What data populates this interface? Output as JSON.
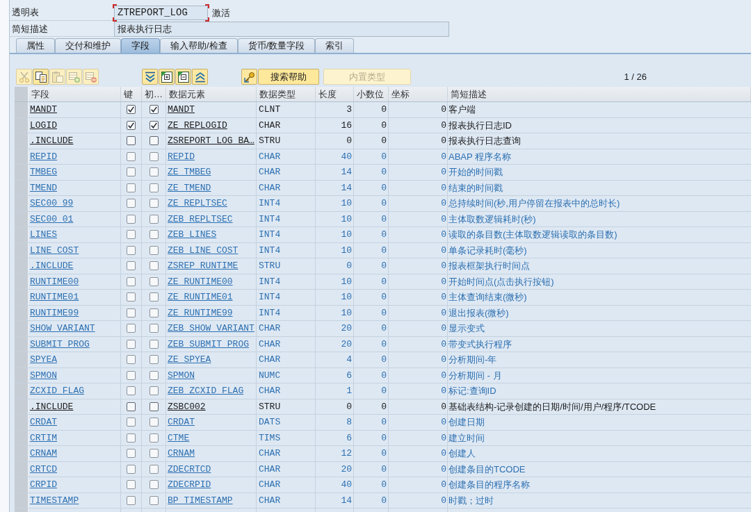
{
  "object": {
    "label": "透明表",
    "value": "ZTREPORT_LOG",
    "focused": true,
    "status": "激活"
  },
  "short_description": {
    "label": "简短描述",
    "value": "报表执行日志"
  },
  "tabs": [
    {
      "label": "属性",
      "selected": false
    },
    {
      "label": "交付和维护",
      "selected": false
    },
    {
      "label": "字段",
      "selected": true
    },
    {
      "label": "输入帮助/检查",
      "selected": false
    },
    {
      "label": "货币/数量字段",
      "selected": false
    },
    {
      "label": "索引",
      "selected": false
    }
  ],
  "toolbar": {
    "groups": [
      {
        "buttons": [
          {
            "kind": "cut",
            "disabled": true
          },
          {
            "kind": "copy",
            "disabled": false
          },
          {
            "kind": "paste",
            "disabled": true
          },
          {
            "kind": "insert_row",
            "disabled": true
          },
          {
            "kind": "delete_row",
            "disabled": true
          }
        ]
      },
      {
        "buttons": [
          {
            "kind": "move_down",
            "disabled": false
          },
          {
            "kind": "expand_all",
            "disabled": false
          },
          {
            "kind": "collapse_all",
            "disabled": false
          },
          {
            "kind": "move_up",
            "disabled": false
          }
        ]
      },
      {
        "buttons": [
          {
            "kind": "search_help",
            "disabled": false
          },
          {
            "kind": "text",
            "label": "搜索帮助",
            "disabled": false
          },
          {
            "kind": "text",
            "label": "内置类型",
            "disabled": true
          }
        ]
      }
    ],
    "pager": "1 / 26"
  },
  "table": {
    "columns": [
      "字段",
      "键",
      "初…",
      "数据元素",
      "数据类型",
      "长度",
      "小数位",
      "坐标",
      "简短描述"
    ],
    "rows": [
      {
        "field": "MANDT",
        "key": true,
        "initial": true,
        "data_element": "MANDT",
        "data_type": "CLNT",
        "length": "3",
        "decimals": "0",
        "coordinate": "0",
        "description": "客户端",
        "from_include": false
      },
      {
        "field": "LOGID",
        "key": true,
        "initial": true,
        "data_element": "ZE_REPLOGID",
        "data_type": "CHAR",
        "length": "16",
        "decimals": "0",
        "coordinate": "0",
        "description": "报表执行日志ID",
        "from_include": false
      },
      {
        "field": ".INCLUDE",
        "key": false,
        "initial": false,
        "data_element": "ZSREPORT_LOG_BA…",
        "data_type": "STRU",
        "length": "0",
        "decimals": "0",
        "coordinate": "0",
        "description": "报表执行日志查询",
        "from_include": false
      },
      {
        "field": "REPID",
        "key": false,
        "initial": false,
        "data_element": "REPID",
        "data_type": "CHAR",
        "length": "40",
        "decimals": "0",
        "coordinate": "0",
        "description": "ABAP 程序名称",
        "from_include": true
      },
      {
        "field": "TMBEG",
        "key": false,
        "initial": false,
        "data_element": "ZE_TMBEG",
        "data_type": "CHAR",
        "length": "14",
        "decimals": "0",
        "coordinate": "0",
        "description": "开始的时间戳",
        "from_include": true
      },
      {
        "field": "TMEND",
        "key": false,
        "initial": false,
        "data_element": "ZE_TMEND",
        "data_type": "CHAR",
        "length": "14",
        "decimals": "0",
        "coordinate": "0",
        "description": "结束的时间戳",
        "from_include": true
      },
      {
        "field": "SEC00_99",
        "key": false,
        "initial": false,
        "data_element": "ZE_REPLTSEC",
        "data_type": "INT4",
        "length": "10",
        "decimals": "0",
        "coordinate": "0",
        "description": "总持续时间(秒,用户停留在报表中的总时长)",
        "from_include": true
      },
      {
        "field": "SEC00_01",
        "key": false,
        "initial": false,
        "data_element": "ZEB_REPLTSEC",
        "data_type": "INT4",
        "length": "10",
        "decimals": "0",
        "coordinate": "0",
        "description": "主体取数逻辑耗时(秒)",
        "from_include": true
      },
      {
        "field": "LINES",
        "key": false,
        "initial": false,
        "data_element": "ZEB_LINES",
        "data_type": "INT4",
        "length": "10",
        "decimals": "0",
        "coordinate": "0",
        "description": "读取的条目数(主体取数逻辑读取的条目数)",
        "from_include": true
      },
      {
        "field": "LINE_COST",
        "key": false,
        "initial": false,
        "data_element": "ZEB_LINE_COST",
        "data_type": "INT4",
        "length": "10",
        "decimals": "0",
        "coordinate": "0",
        "description": "单条记录耗时(毫秒)",
        "from_include": true
      },
      {
        "field": ".INCLUDE",
        "key": false,
        "initial": false,
        "data_element": "ZSREP_RUNTIME",
        "data_type": "STRU",
        "length": "0",
        "decimals": "0",
        "coordinate": "0",
        "description": "报表框架执行时间点",
        "from_include": true
      },
      {
        "field": "RUNTIME00",
        "key": false,
        "initial": false,
        "data_element": "ZE_RUNTIME00",
        "data_type": "INT4",
        "length": "10",
        "decimals": "0",
        "coordinate": "0",
        "description": "开始时间点(点击执行按钮)",
        "from_include": true
      },
      {
        "field": "RUNTIME01",
        "key": false,
        "initial": false,
        "data_element": "ZE_RUNTIME01",
        "data_type": "INT4",
        "length": "10",
        "decimals": "0",
        "coordinate": "0",
        "description": "主体查询结束(微秒)",
        "from_include": true
      },
      {
        "field": "RUNTIME99",
        "key": false,
        "initial": false,
        "data_element": "ZE_RUNTIME99",
        "data_type": "INT4",
        "length": "10",
        "decimals": "0",
        "coordinate": "0",
        "description": "退出报表(微秒)",
        "from_include": true
      },
      {
        "field": "SHOW_VARIANT",
        "key": false,
        "initial": false,
        "data_element": "ZEB_SHOW_VARIANT",
        "data_type": "CHAR",
        "length": "20",
        "decimals": "0",
        "coordinate": "0",
        "description": "显示变式",
        "from_include": true
      },
      {
        "field": "SUBMIT_PROG",
        "key": false,
        "initial": false,
        "data_element": "ZEB_SUBMIT_PROG",
        "data_type": "CHAR",
        "length": "20",
        "decimals": "0",
        "coordinate": "0",
        "description": "带变式执行程序",
        "from_include": true
      },
      {
        "field": "SPYEA",
        "key": false,
        "initial": false,
        "data_element": "ZE_SPYEA",
        "data_type": "CHAR",
        "length": "4",
        "decimals": "0",
        "coordinate": "0",
        "description": "分析期间-年",
        "from_include": true
      },
      {
        "field": "SPMON",
        "key": false,
        "initial": false,
        "data_element": "SPMON",
        "data_type": "NUMC",
        "length": "6",
        "decimals": "0",
        "coordinate": "0",
        "description": "分析期间 - 月",
        "from_include": true
      },
      {
        "field": "ZCXID_FLAG",
        "key": false,
        "initial": false,
        "data_element": "ZEB_ZCXID_FLAG",
        "data_type": "CHAR",
        "length": "1",
        "decimals": "0",
        "coordinate": "0",
        "description": "标记:查询ID",
        "from_include": true
      },
      {
        "field": ".INCLUDE",
        "key": false,
        "initial": false,
        "data_element": "ZSBC002",
        "data_type": "STRU",
        "length": "0",
        "decimals": "0",
        "coordinate": "0",
        "description": "基础表结构-记录创建的日期/时间/用户/程序/TCODE",
        "from_include": false
      },
      {
        "field": "CRDAT",
        "key": false,
        "initial": false,
        "data_element": "CRDAT",
        "data_type": "DATS",
        "length": "8",
        "decimals": "0",
        "coordinate": "0",
        "description": "创建日期",
        "from_include": true
      },
      {
        "field": "CRTIM",
        "key": false,
        "initial": false,
        "data_element": "CTME",
        "data_type": "TIMS",
        "length": "6",
        "decimals": "0",
        "coordinate": "0",
        "description": "建立时间",
        "from_include": true
      },
      {
        "field": "CRNAM",
        "key": false,
        "initial": false,
        "data_element": "CRNAM",
        "data_type": "CHAR",
        "length": "12",
        "decimals": "0",
        "coordinate": "0",
        "description": "创建人",
        "from_include": true
      },
      {
        "field": "CRTCD",
        "key": false,
        "initial": false,
        "data_element": "ZDECRTCD",
        "data_type": "CHAR",
        "length": "20",
        "decimals": "0",
        "coordinate": "0",
        "description": "创建条目的TCODE",
        "from_include": true
      },
      {
        "field": "CRPID",
        "key": false,
        "initial": false,
        "data_element": "ZDECRPID",
        "data_type": "CHAR",
        "length": "40",
        "decimals": "0",
        "coordinate": "0",
        "description": "创建条目的程序名称",
        "from_include": true
      },
      {
        "field": "TIMESTAMP",
        "key": false,
        "initial": false,
        "data_element": "BP_TIMESTAMP",
        "data_type": "CHAR",
        "length": "14",
        "decimals": "0",
        "coordinate": "0",
        "description": "时戳；过时",
        "from_include": true
      }
    ]
  }
}
